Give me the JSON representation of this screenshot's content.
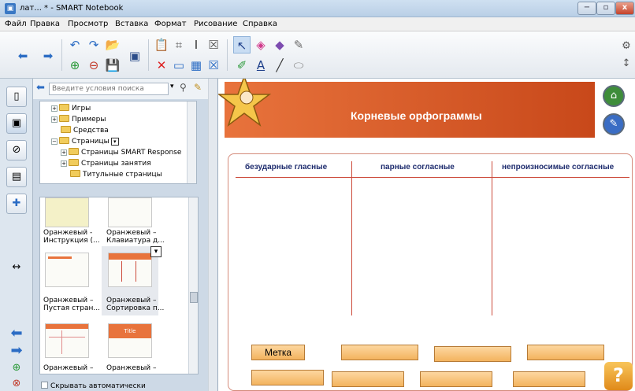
{
  "window": {
    "title": "лат... * - SMART Notebook",
    "min": "−",
    "max": "▫",
    "close": "x"
  },
  "menu": [
    "Файл",
    "Правка",
    "Просмотр",
    "Вставка",
    "Формат",
    "Рисование",
    "Справка"
  ],
  "toolbar_icons": {
    "back": "⬅",
    "forward": "➡",
    "undo": "↶",
    "redo": "↷",
    "open": "📂",
    "add_page": "⊕",
    "delete_page": "⊖",
    "save": "💾",
    "screen": "▣",
    "paste": "📋",
    "clear": "✕",
    "screen_shade": "▭",
    "table": "▦",
    "close_x": "☒",
    "capture": "⌗",
    "text": "Ⅰ",
    "pointer": "↖",
    "fill": "◈",
    "eraser": "◆",
    "pen": "✎",
    "creative_pen": "✐",
    "font": "A",
    "line": "╱",
    "shape_eraser": "⬭",
    "gear": "⚙",
    "arrows": "↕"
  },
  "sidebar": {
    "tabs": [
      "▯",
      "▣",
      "⊘",
      "▤",
      "✚",
      "↔",
      "⬅",
      "➡",
      "⊕",
      "⊗"
    ],
    "search_placeholder": "Введите условия поиска",
    "tree": [
      {
        "label": "Игры",
        "expand": "+"
      },
      {
        "label": "Примеры",
        "expand": "+"
      },
      {
        "label": "Средства",
        "expand": ""
      },
      {
        "label": "Страницы",
        "expand": "−"
      },
      {
        "label": "Страницы SMART Response",
        "expand": "+"
      },
      {
        "label": "Страницы занятия",
        "expand": "+"
      },
      {
        "label": "Титульные страницы",
        "expand": ""
      }
    ],
    "thumbnails": [
      {
        "caption": "Оранжевый - Инструкция (..."
      },
      {
        "caption": "Оранжевый – Клавиатура д..."
      },
      {
        "caption": "Оранжевый – Пустая стран..."
      },
      {
        "caption": "Оранжевый – Сортировка п..."
      },
      {
        "caption": "Оранжевый –"
      },
      {
        "caption": "Оранжевый –"
      }
    ],
    "thumb_title_text": "Title",
    "autohide_label": "Скрывать автоматически"
  },
  "canvas": {
    "title": "Корневые орфограммы",
    "columns": [
      "безударные гласные",
      "парные согласные",
      "непроизносимые  согласные"
    ],
    "label_text": "Метка",
    "help": "?"
  },
  "colors": {
    "header": "#d9592a",
    "line": "#cc4a3a",
    "label": "#f7c07a"
  }
}
